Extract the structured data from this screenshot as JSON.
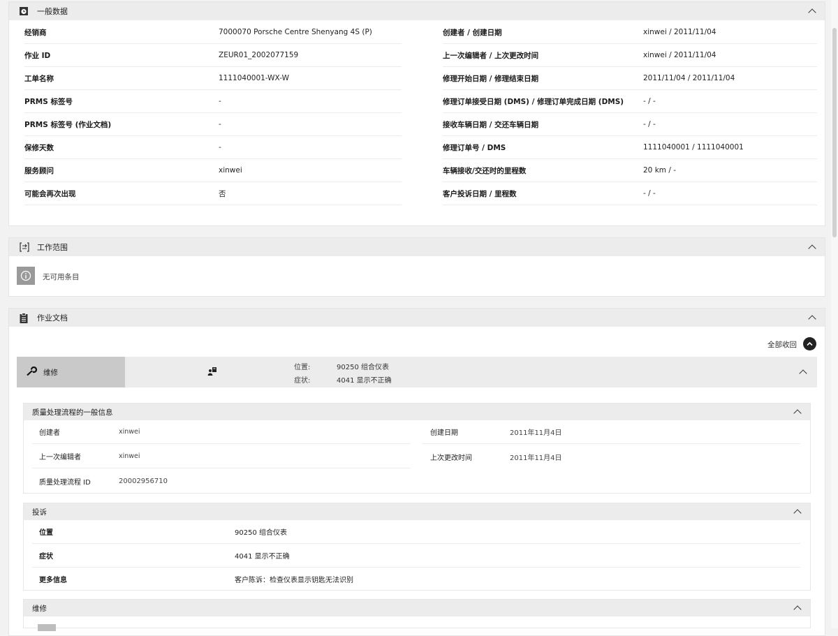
{
  "general": {
    "title": "一般数据",
    "left_rows": [
      {
        "label": "经销商",
        "value": "7000070 Porsche Centre Shenyang 4S (P)"
      },
      {
        "label": "作业 ID",
        "value": "ZEUR01_2002077159"
      },
      {
        "label": "工单名称",
        "value": "1111040001-WX-W"
      },
      {
        "label": "PRMS 标签号",
        "value": "-"
      },
      {
        "label": "PRMS 标签号 (作业文档)",
        "value": "-"
      },
      {
        "label": "保修天数",
        "value": "-"
      },
      {
        "label": "服务顾问",
        "value": "xinwei"
      },
      {
        "label": "可能会再次出现",
        "value": "否"
      }
    ],
    "right_rows": [
      {
        "label": "创建者 / 创建日期",
        "value": "xinwei / 2011/11/04"
      },
      {
        "label": "上一次编辑者 / 上次更改时间",
        "value": "xinwei / 2011/11/04"
      },
      {
        "label": "修理开始日期 / 修理结束日期",
        "value": "2011/11/04 / 2011/11/04"
      },
      {
        "label": "修理订单接受日期 (DMS) / 修理订单完成日期 (DMS)",
        "value": "- / -"
      },
      {
        "label": "接收车辆日期 / 交还车辆日期",
        "value": "- / -"
      },
      {
        "label": "修理订单号 / DMS",
        "value": "1111040001 / 1111040001"
      },
      {
        "label": "车辆接收/交还时的里程数",
        "value": "20 km / -"
      },
      {
        "label": "客户投诉日期 / 里程数",
        "value": "- / -"
      }
    ]
  },
  "scope": {
    "title": "工作范围",
    "empty_text": "无可用条目"
  },
  "docs": {
    "title": "作业文档",
    "collapse_all": "全部收回",
    "tab_repair": "维修",
    "position_label": "位置:",
    "position_value": "90250 组合仪表",
    "symptom_label": "症状:",
    "symptom_value": "4041 显示不正确",
    "quality": {
      "title": "质量处理流程的一般信息",
      "creator_label": "创建者",
      "creator_value": "xinwei",
      "created_label": "创建日期",
      "created_value": "2011年11月4日",
      "editor_label": "上一次编辑者",
      "editor_value": "xinwei",
      "changed_label": "上次更改时间",
      "changed_value": "2011年11月4日",
      "id_label": "质量处理流程 ID",
      "id_value": "20002956710"
    },
    "complaint": {
      "title": "投诉",
      "position_label": "位置",
      "position_value": "90250 组合仪表",
      "symptom_label": "症状",
      "symptom_value": "4041 显示不正确",
      "more_label": "更多信息",
      "more_value": "客户陈诉：检查仪表显示钥匙无法识别"
    },
    "repair": {
      "title": "维修"
    }
  }
}
